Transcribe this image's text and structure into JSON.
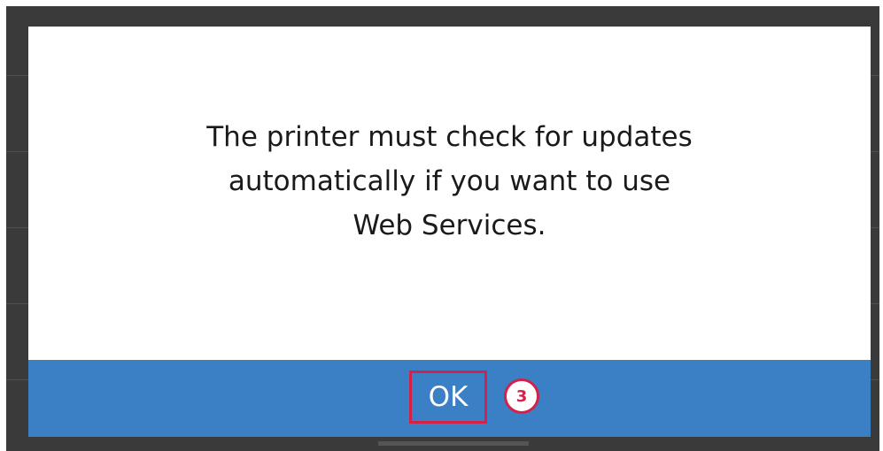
{
  "dialog": {
    "message_line1": "The printer must check for updates",
    "message_line2": "automatically if you want to use",
    "message_line3": "Web Services.",
    "ok_label": "OK"
  },
  "annotation": {
    "step_number": "3"
  },
  "colors": {
    "footer_bar": "#3b7fc4",
    "highlight": "#d2224a",
    "background": "#3a3a3a"
  }
}
